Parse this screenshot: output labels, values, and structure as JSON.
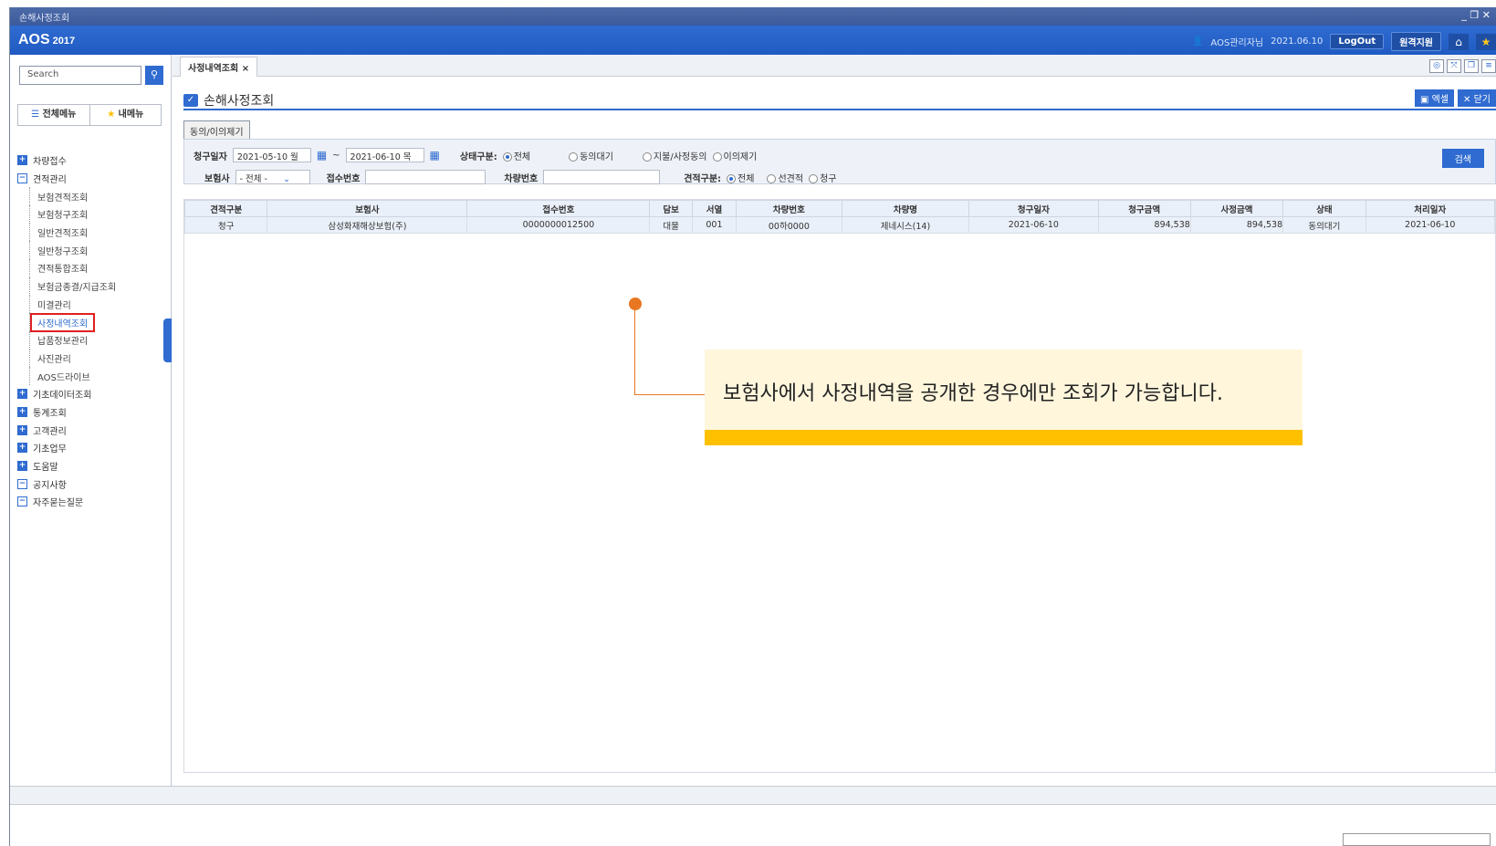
{
  "window": {
    "title": "손해사정조회"
  },
  "header": {
    "logo": "AOS",
    "year": "2017",
    "user": "AOS관리자님",
    "date": "2021.06.10",
    "logout": "LogOut",
    "remote": "원격지원"
  },
  "sidebar": {
    "search_placeholder": "Search",
    "tabs": {
      "all": "전체메뉴",
      "my": "내메뉴"
    },
    "tree": [
      {
        "label": "차량접수",
        "type": "plus"
      },
      {
        "label": "견적관리",
        "type": "minus"
      },
      {
        "label": "보험견적조회",
        "type": "sub"
      },
      {
        "label": "보험청구조회",
        "type": "sub"
      },
      {
        "label": "일반견적조회",
        "type": "sub"
      },
      {
        "label": "일반청구조회",
        "type": "sub"
      },
      {
        "label": "견적통합조회",
        "type": "sub"
      },
      {
        "label": "보험금종결/지급조회",
        "type": "sub"
      },
      {
        "label": "미결관리",
        "type": "sub"
      },
      {
        "label": "사정내역조회",
        "type": "sub-selected"
      },
      {
        "label": "납품정보관리",
        "type": "sub"
      },
      {
        "label": "사진관리",
        "type": "sub"
      },
      {
        "label": "AOS드라이브",
        "type": "sub"
      },
      {
        "label": "기초데이터조회",
        "type": "plus"
      },
      {
        "label": "통계조회",
        "type": "plus"
      },
      {
        "label": "고객관리",
        "type": "plus"
      },
      {
        "label": "기초업무",
        "type": "plus"
      },
      {
        "label": "도움말",
        "type": "plus"
      },
      {
        "label": "공지사항",
        "type": "minus"
      },
      {
        "label": "자주묻는질문",
        "type": "minus"
      }
    ]
  },
  "main": {
    "tab_label": "사정내역조회",
    "page_title": "손해사정조회",
    "excel": "엑셀",
    "close": "닫기",
    "subtab": "동의/이의제기",
    "filter": {
      "date_label": "청구일자",
      "date_from": "2021-05-10 월",
      "date_to": "2021-06-10 목",
      "status_label": "상태구분:",
      "status_opts": [
        "전체",
        "동의대기",
        "지불/사정동의",
        "이의제기"
      ],
      "insurer_label": "보험사",
      "insurer_value": "- 전체 -",
      "receipt_label": "접수번호",
      "car_label": "차량번호",
      "est_label": "견적구분:",
      "est_opts": [
        "전체",
        "선견적",
        "청구"
      ],
      "search_btn": "검색"
    },
    "columns": [
      "견적구분",
      "보험사",
      "접수번호",
      "담보",
      "서열",
      "차량번호",
      "차량명",
      "청구일자",
      "청구금액",
      "사정금액",
      "상태",
      "처리일자"
    ],
    "rows": [
      [
        "청구",
        "삼성화재해상보험(주)",
        "0000000012500",
        "대물",
        "001",
        "00하0000",
        "제네시스(14)",
        "2021-06-10",
        "894,538",
        "894,538",
        "동의대기",
        "2021-06-10"
      ]
    ]
  },
  "callout": {
    "text": "보험사에서 사정내역을 공개한 경우에만 조회가 가능합니다."
  }
}
